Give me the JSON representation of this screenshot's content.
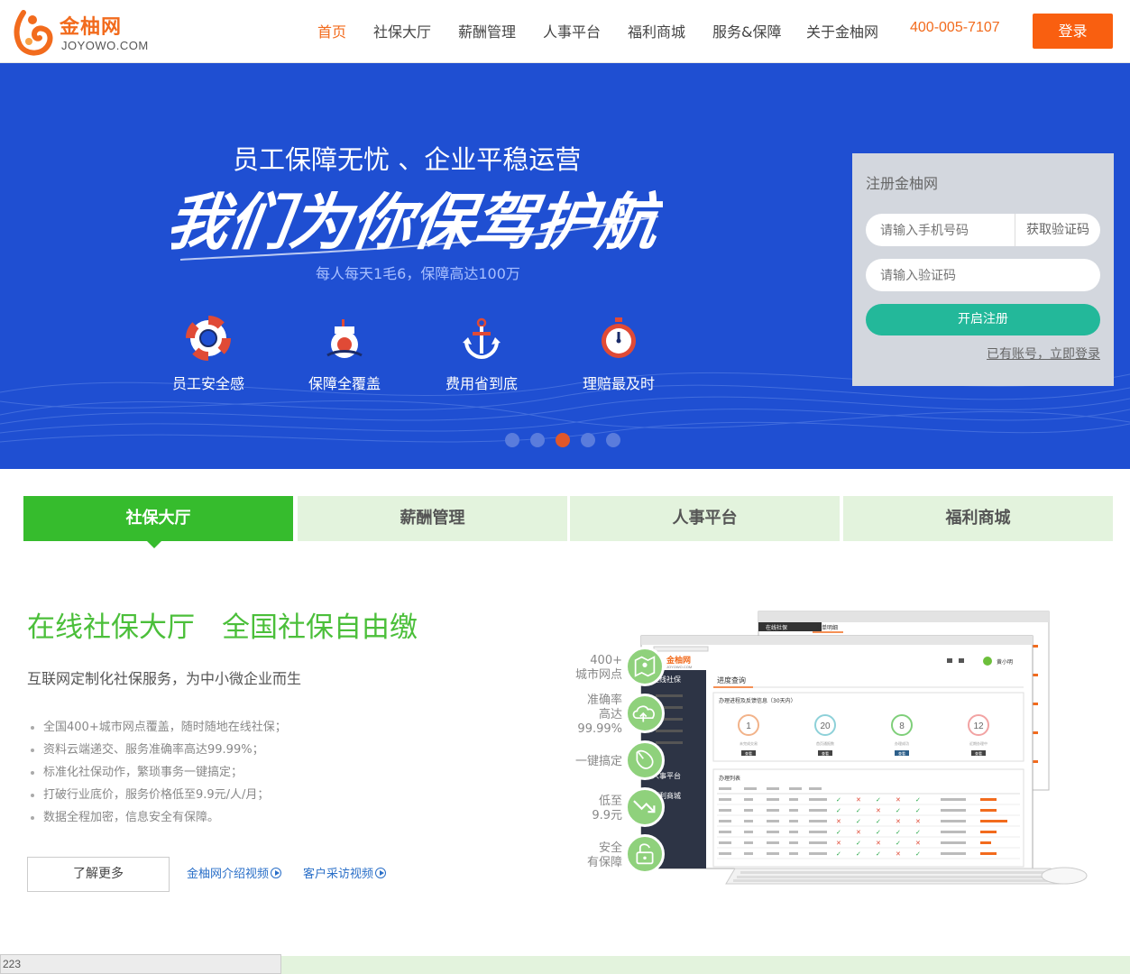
{
  "header": {
    "logo_text": "金柚网",
    "logo_sub": "JOYOWO.COM",
    "nav": [
      "首页",
      "社保大厅",
      "薪酬管理",
      "人事平台",
      "福利商城",
      "服务&保障",
      "关于金柚网"
    ],
    "phone": "400-005-7107",
    "login": "登录",
    "accent": "#f26b1d"
  },
  "banner": {
    "title": "员工保障无忧 、企业平稳运营",
    "slogan": "我们为你保驾护航",
    "subtitle": "每人每天1毛6，保障高达100万",
    "features": [
      "员工安全感",
      "保障全覆盖",
      "费用省到底",
      "理赔最及时"
    ],
    "dots": 5,
    "active_dot": 3,
    "bg_color": "#1f4fd2"
  },
  "register": {
    "title": "注册金柚网",
    "phone_placeholder": "请输入手机号码",
    "get_code": "获取验证码",
    "code_placeholder": "请输入验证码",
    "submit": "开启注册",
    "login_link": "已有账号，立即登录"
  },
  "tabs": [
    "社保大厅",
    "薪酬管理",
    "人事平台",
    "福利商城"
  ],
  "content": {
    "headline_a": "在线社保大厅",
    "headline_b": "全国社保自由缴",
    "subtitle": "互联网定制化社保服务，为中小微企业而生",
    "bullets": [
      "全国400+城市网点覆盖，随时随地在线社保；",
      "资料云端递交、服务准确率高达99.99%；",
      "标准化社保动作，繁琐事务一键搞定；",
      "打破行业底价，服务价格低至9.9元/人/月；",
      "数据全程加密，信息安全有保障。"
    ],
    "more": "了解更多",
    "video_a": "金柚网介绍视频",
    "video_b": "客户采访视频"
  },
  "illustration": {
    "labels": [
      [
        "400+",
        "城市网点"
      ],
      [
        "准确率",
        "高达",
        "99.99%"
      ],
      [
        "一键搞定"
      ],
      [
        "低至",
        "9.9元"
      ],
      [
        "安全",
        "有保障"
      ]
    ],
    "screen_menu": "在线社保",
    "screen_tab": "进度查询",
    "screen_section": "办理进程及反馈信息（30天内）",
    "stats": [
      [
        "1",
        "未完成交易"
      ],
      [
        "20",
        "首页通报数"
      ],
      [
        "8",
        "办理成功"
      ],
      [
        "12",
        "近期办理中"
      ]
    ],
    "stat_btn": "查看",
    "list_title": "办理列表",
    "user": "黄小明",
    "brand": "JOYOWO.COM",
    "back_tab": "账单明细",
    "back_menu": "在线社保"
  },
  "status_bar": "223"
}
